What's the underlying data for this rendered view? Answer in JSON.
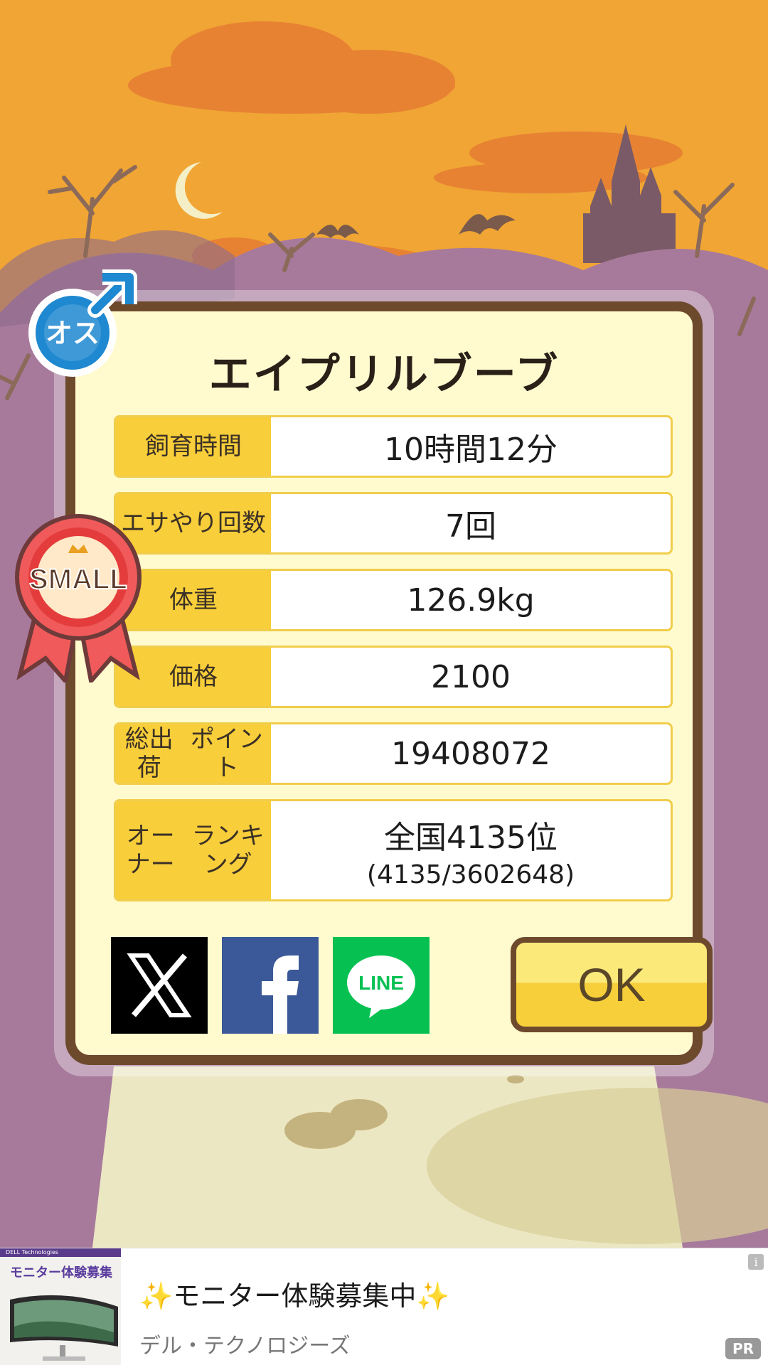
{
  "pet": {
    "name": "エイプリルブーブ",
    "gender_badge": "オス",
    "size_badge": "SMALL"
  },
  "stats": [
    {
      "label_lines": [
        "飼育時間"
      ],
      "value": "10時間12分",
      "sub": ""
    },
    {
      "label_lines": [
        "エサやり回数"
      ],
      "value": "7回",
      "sub": ""
    },
    {
      "label_lines": [
        "体重"
      ],
      "value": "126.9kg",
      "sub": ""
    },
    {
      "label_lines": [
        "価格"
      ],
      "value": "2100",
      "sub": ""
    },
    {
      "label_lines": [
        "総出荷",
        "ポイント"
      ],
      "value": "19408072",
      "sub": ""
    },
    {
      "label_lines": [
        "オーナー",
        "ランキング"
      ],
      "value": "全国4135位",
      "sub": "(4135/3602648)"
    }
  ],
  "actions": {
    "share_x_icon": "x-logo-icon",
    "share_facebook_icon": "facebook-logo-icon",
    "share_line_label": "LINE",
    "ok_label": "OK"
  },
  "ad": {
    "thumb_brand": "DELL Technologies",
    "thumb_title": "モニター体験募集",
    "title": "✨モニター体験募集中✨",
    "sponsor": "デル・テクノロジーズ",
    "info_label": "i",
    "pr_label": "PR"
  },
  "colors": {
    "sky": "#f0a534",
    "hills": "#a77a9c",
    "dialog_border": "#6e4a2d",
    "dialog_bg": "#fffbcf",
    "label_bg": "#f8ce3a",
    "line_green": "#06c152",
    "facebook_blue": "#3b5998"
  }
}
